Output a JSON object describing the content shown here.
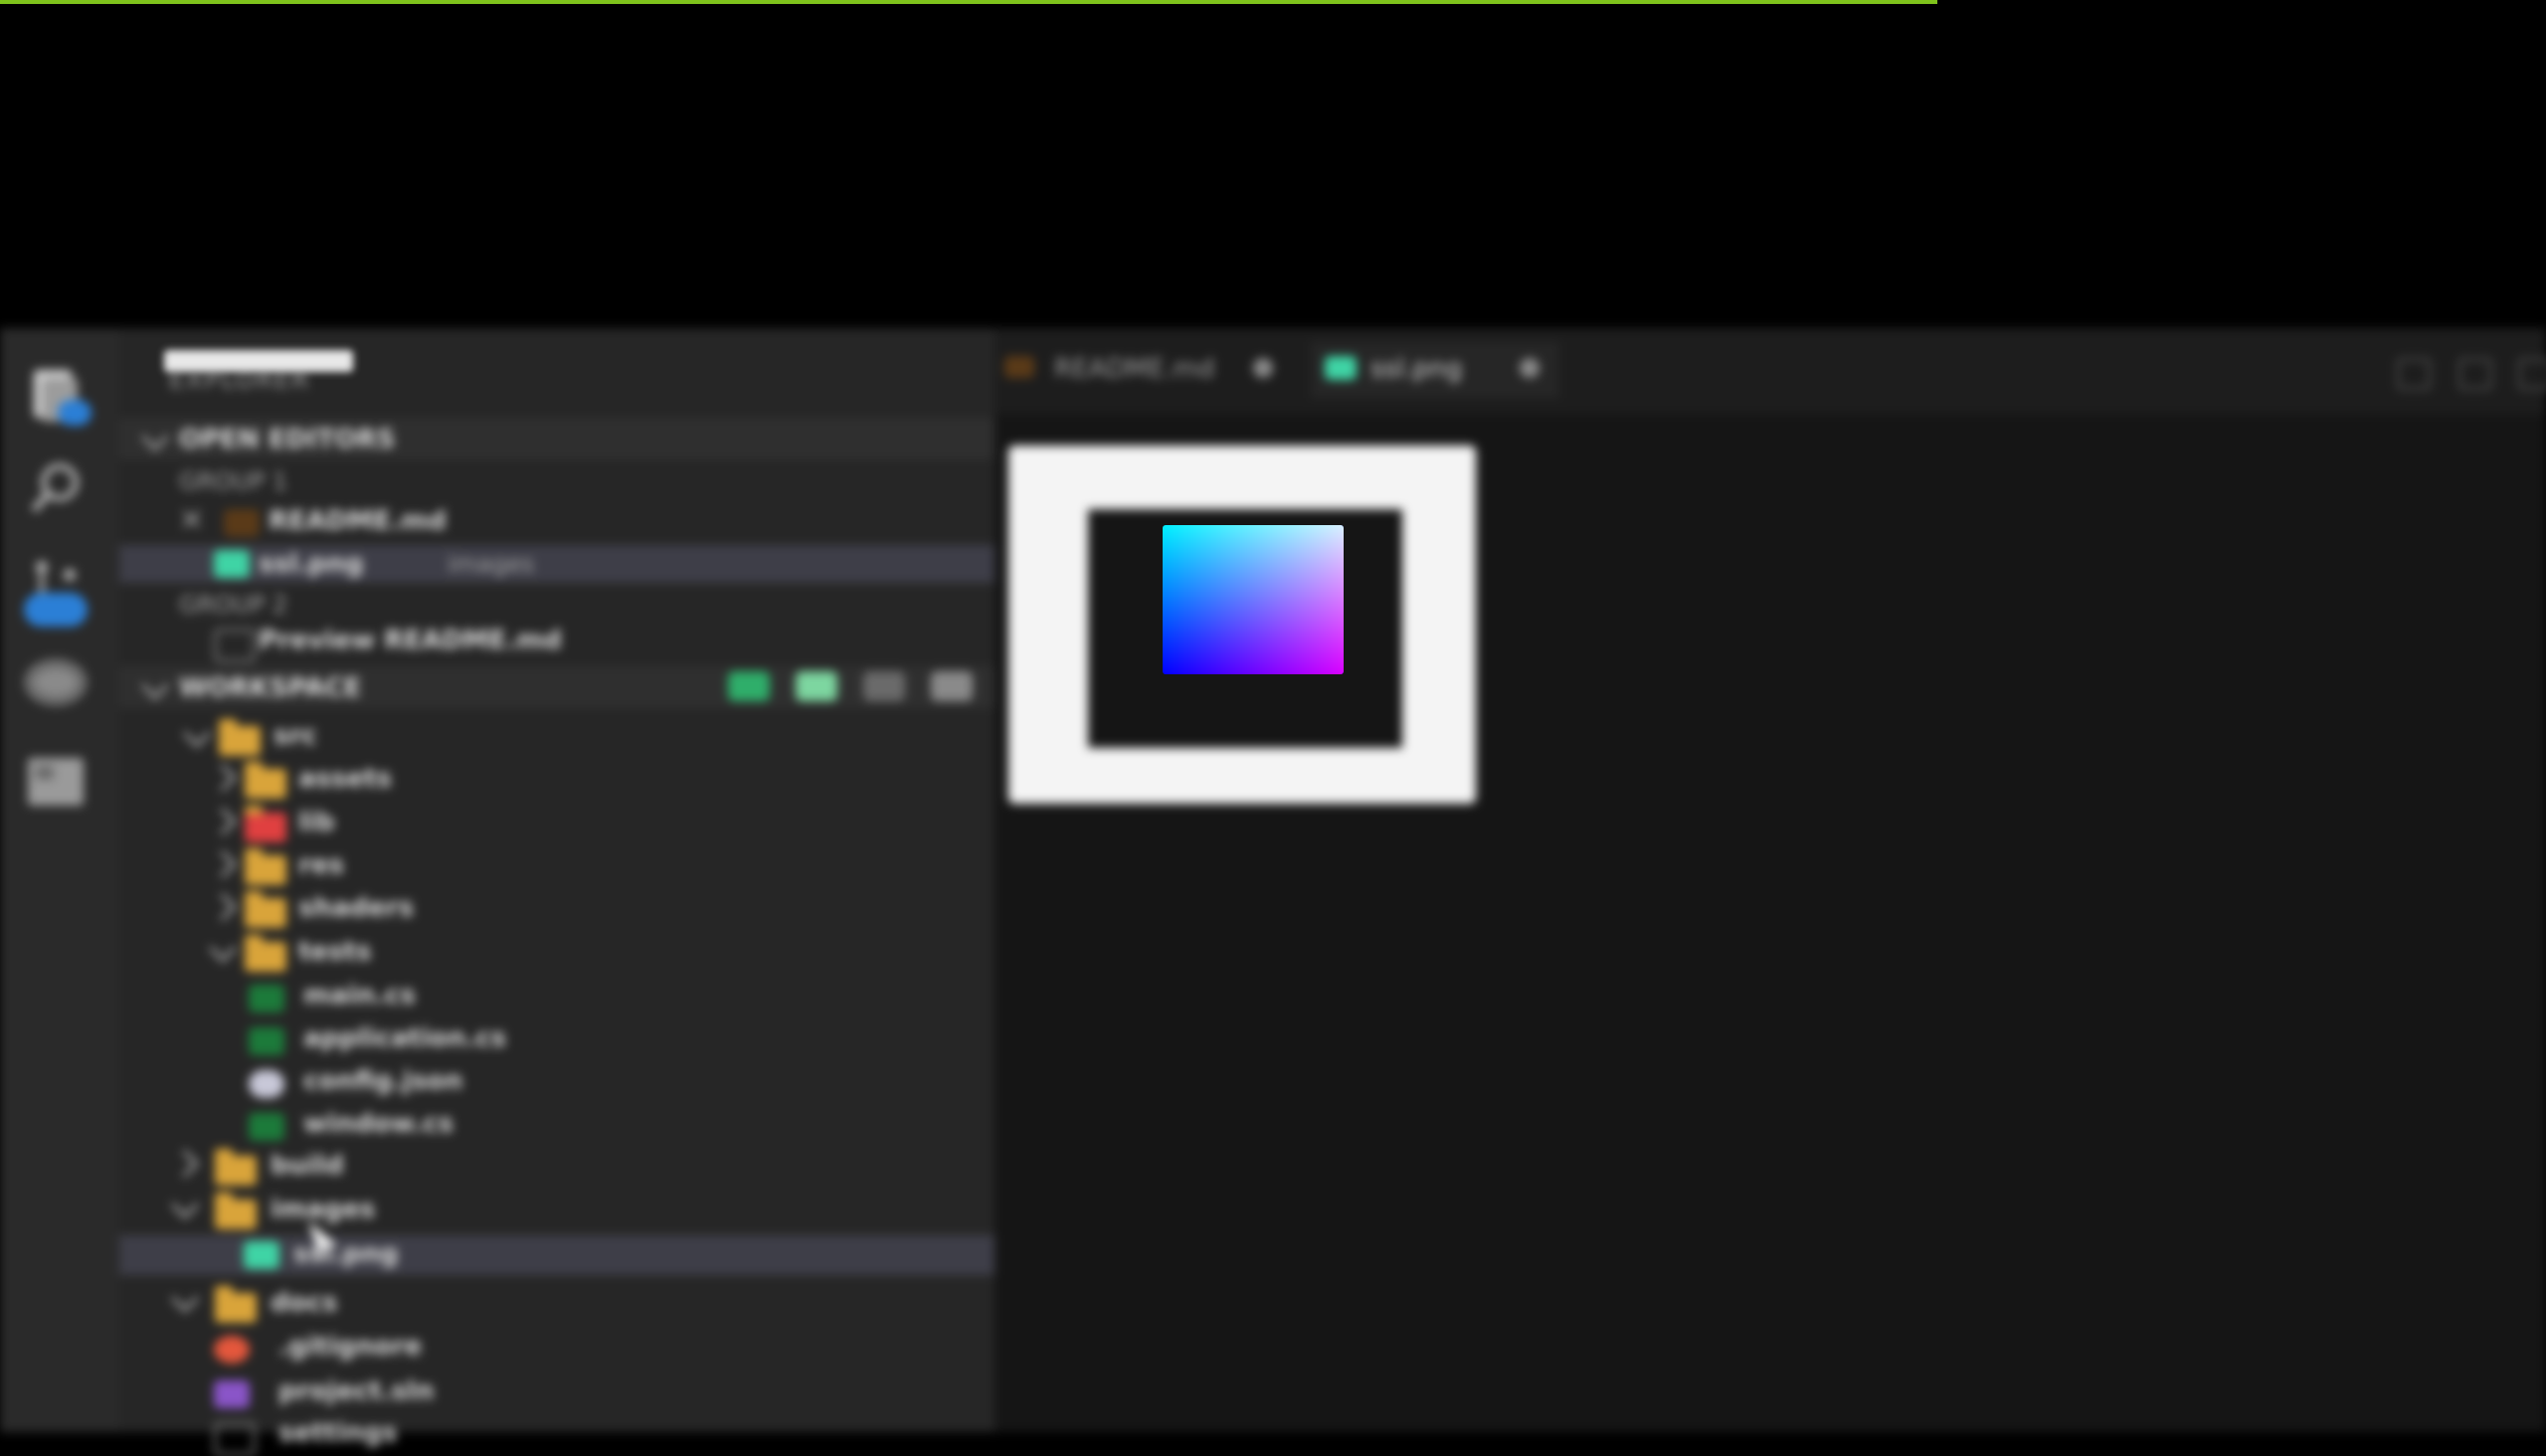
{
  "colors": {
    "top_bar": "#7fc31c",
    "background": "#000000",
    "activity_bar": "#2a2a2a",
    "side_bar": "#262626",
    "editor": "#151515",
    "folder": "#d9a43a",
    "badge": "#2b7fd6",
    "selection": "#3e3e48"
  },
  "activity_bar": {
    "items": [
      {
        "icon": "files-icon",
        "badge": true
      },
      {
        "icon": "search-icon",
        "badge": false
      },
      {
        "icon": "source-control-icon",
        "badge": true
      },
      {
        "icon": "run-debug-icon",
        "badge": false
      },
      {
        "icon": "extensions-icon",
        "badge": false
      }
    ]
  },
  "sidebar": {
    "title": "EXPLORER",
    "open_editors": {
      "header": "OPEN EDITORS",
      "groups": [
        {
          "label": "GROUP 1",
          "files": [
            {
              "name": "README.md",
              "icon": "markdown-icon"
            }
          ]
        },
        {
          "label": "GROUP 2",
          "files": [
            {
              "name": "Preview README.md",
              "icon": "preview-icon"
            }
          ]
        }
      ],
      "selected_file": {
        "name": "ssl.png",
        "icon": "image-icon"
      }
    },
    "workspace": {
      "header": "WORKSPACE",
      "actions": [
        "new-file-icon",
        "new-folder-icon",
        "refresh-icon",
        "collapse-all-icon"
      ],
      "tree": [
        {
          "name": "src",
          "type": "folder",
          "depth": 1,
          "open": true
        },
        {
          "name": "assets",
          "type": "folder",
          "depth": 2,
          "open": false
        },
        {
          "name": "lib",
          "type": "folder",
          "depth": 2,
          "open": false,
          "color": "red"
        },
        {
          "name": "res",
          "type": "folder",
          "depth": 2,
          "open": false
        },
        {
          "name": "shaders",
          "type": "folder",
          "depth": 2,
          "open": false
        },
        {
          "name": "tests",
          "type": "folder",
          "depth": 2,
          "open": true
        },
        {
          "name": "main.cs",
          "type": "csharp",
          "depth": 3
        },
        {
          "name": "application.cs",
          "type": "csharp",
          "depth": 3
        },
        {
          "name": "config.json",
          "type": "json",
          "depth": 3
        },
        {
          "name": "window.cs",
          "type": "csharp",
          "depth": 3
        },
        {
          "name": "build",
          "type": "folder",
          "depth": 1,
          "open": false
        },
        {
          "name": "images",
          "type": "folder",
          "depth": 1,
          "open": true
        },
        {
          "name": "ssl.png",
          "type": "image",
          "depth": 2,
          "selected": true
        },
        {
          "name": "docs",
          "type": "folder",
          "depth": 1,
          "open": true
        },
        {
          "name": ".gitignore",
          "type": "git",
          "depth": 2
        },
        {
          "name": "project.sln",
          "type": "solution",
          "depth": 2
        },
        {
          "name": "settings",
          "type": "file",
          "depth": 2
        }
      ]
    }
  },
  "editor": {
    "tabs": [
      {
        "name": "README.md",
        "icon": "markdown-icon",
        "active": false
      },
      {
        "name": "ssl.png",
        "icon": "image-icon",
        "active": true
      }
    ],
    "window_buttons": [
      "split-editor-icon",
      "more-actions-icon"
    ],
    "preview": {
      "file": "ssl.png",
      "content": "color-gradient-image"
    }
  }
}
